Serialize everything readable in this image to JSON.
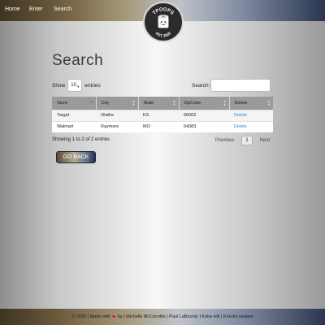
{
  "nav": {
    "items": [
      {
        "label": "Home"
      },
      {
        "label": "Enter"
      },
      {
        "label": "Search"
      }
    ],
    "logo": {
      "top_text": "TPOOPS",
      "bottom_text": "EST. 2020"
    }
  },
  "page": {
    "title": "Search"
  },
  "length_control": {
    "show_label": "Show",
    "selected": "10",
    "entries_label": "entries"
  },
  "search": {
    "label": "Search:",
    "value": "",
    "placeholder": ""
  },
  "table": {
    "columns": [
      "Store",
      "City",
      "State",
      "ZipCode",
      "Delete"
    ],
    "sorted_column": "Store",
    "rows": [
      {
        "store": "Target",
        "city": "Olathe",
        "state": "KS",
        "zip": "66062",
        "action": "Delete"
      },
      {
        "store": "Walmart",
        "city": "Raymore",
        "state": "MO",
        "zip": "64083",
        "action": "Delete"
      }
    ]
  },
  "info": "Showing 1 to 2 of 2 entries",
  "pagination": {
    "previous": "Previous",
    "current": "1",
    "next": "Next"
  },
  "go_back_label": "GO BACK",
  "footer": {
    "before_heart": "© 2020 | Made with",
    "after_heart": "by | Michelle McConville | Paul LaBounty | Kobe Hill | Kendra Hatlam"
  },
  "colors": {
    "link_blue": "#3b7fd0",
    "heart_red": "#c21f2e",
    "header_gray": "#9a9a9a"
  }
}
